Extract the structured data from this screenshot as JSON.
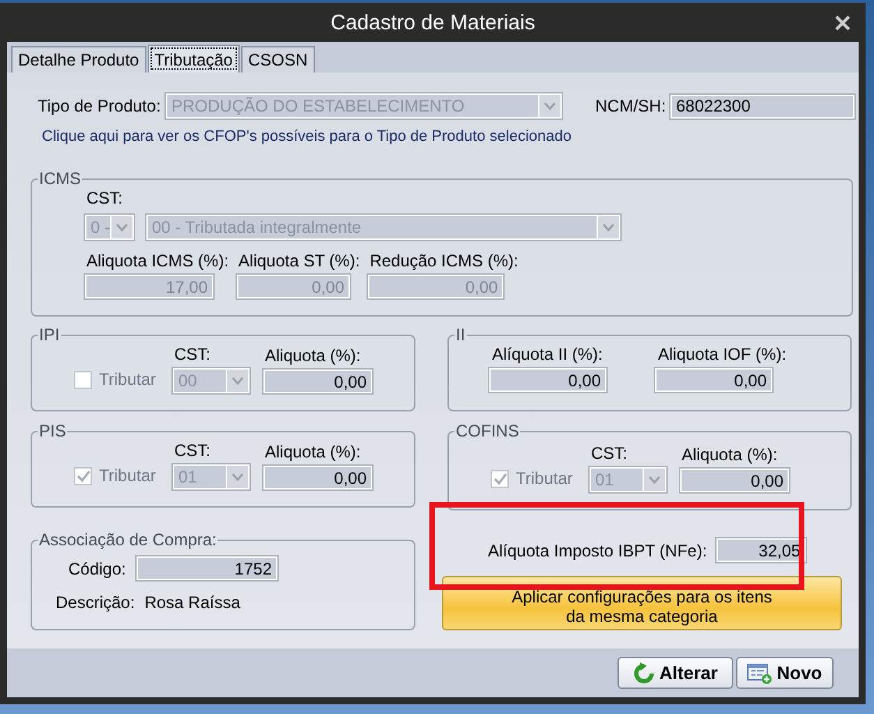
{
  "window": {
    "title": "Cadastro de Materiais"
  },
  "tabs": [
    {
      "label": "Detalhe Produto",
      "selected": false
    },
    {
      "label": "Tributação",
      "selected": true
    },
    {
      "label": "CSOSN",
      "selected": false
    }
  ],
  "produto": {
    "label": "Tipo de Produto:",
    "value": "PRODUÇÃO DO ESTABELECIMENTO",
    "disabled": true
  },
  "ncm": {
    "label": "NCM/SH:",
    "value": "68022300"
  },
  "cfop_link": "Clique aqui para ver os CFOP's possíveis para o Tipo de Produto selecionado",
  "icms": {
    "title": "ICMS",
    "cst_label": "CST:",
    "cst_code": "0 -",
    "cst_description": "00 - Tributada integralmente",
    "disabled": true,
    "fields": [
      {
        "label": "Aliquota ICMS (%):",
        "value": "17,00"
      },
      {
        "label": "Aliquota ST (%):",
        "value": "0,00"
      },
      {
        "label": "Redução ICMS (%):",
        "value": "0,00"
      }
    ]
  },
  "ipi": {
    "title": "IPI",
    "tributar": {
      "label": "Tributar",
      "checked": false
    },
    "cst_label": "CST:",
    "cst": "00",
    "aliquota_label": "Aliquota (%):",
    "aliquota": "0,00"
  },
  "ii": {
    "title": "II",
    "fields": [
      {
        "label": "Alíquota II (%):",
        "value": "0,00"
      },
      {
        "label": "Aliquota IOF (%):",
        "value": "0,00"
      }
    ]
  },
  "pis": {
    "title": "PIS",
    "tributar": {
      "label": "Tributar",
      "checked": true
    },
    "cst_label": "CST:",
    "cst": "01",
    "aliquota_label": "Aliquota (%):",
    "aliquota": "0,00"
  },
  "cofins": {
    "title": "COFINS",
    "tributar": {
      "label": "Tributar",
      "checked": true
    },
    "cst_label": "CST:",
    "cst": "01",
    "aliquota_label": "Aliquota (%):",
    "aliquota": "0,00"
  },
  "compra": {
    "title": "Associação de Compra:",
    "codigo_label": "Código:",
    "codigo": "1752",
    "descricao_label": "Descrição:",
    "descricao": "Rosa Raíssa"
  },
  "ibpt": {
    "label": "Alíquota Imposto IBPT (NFe):",
    "value": "32,05",
    "highlighted": true
  },
  "apply_button": {
    "lines": [
      "Aplicar configurações para os itens",
      "da mesma categoria"
    ]
  },
  "footer_buttons": [
    {
      "kind": "refresh",
      "label": "Alterar"
    },
    {
      "kind": "new",
      "label": "Novo"
    }
  ]
}
